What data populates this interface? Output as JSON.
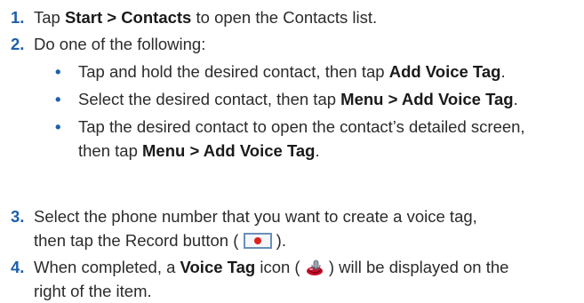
{
  "steps": [
    {
      "num": "1.",
      "t1": "Tap ",
      "b1": "Start > Contacts",
      "t2": " to open the Contacts list."
    },
    {
      "num": "2.",
      "t1": "Do one of the following:"
    },
    {
      "num": "3.",
      "t1": "Select the phone number that you want to create a voice tag,",
      "t2": "then tap the Record button (",
      "t3": ")."
    },
    {
      "num": "4.",
      "t1": "When completed, a ",
      "b1": "Voice Tag",
      "t2": " icon (",
      "t3": ") will be displayed on the",
      "t4": "right of the item."
    }
  ],
  "bullets": [
    {
      "dot": "•",
      "t1": "Tap and hold the desired contact, then tap ",
      "b1": "Add Voice Tag",
      "t2": "."
    },
    {
      "dot": "•",
      "t1": "Select the desired contact, then tap ",
      "b1": "Menu > Add Voice Tag",
      "t2": "."
    },
    {
      "dot": "•",
      "t1": "Tap the desired contact to open the contact’s detailed screen,",
      "t2": "then tap ",
      "b1": "Menu > Add Voice Tag",
      "t3": "."
    }
  ],
  "icons": {
    "record": "record-button-icon",
    "voice_tag": "voice-tag-icon"
  },
  "colors": {
    "number": "#1e5fa8",
    "text": "#2b2b2b",
    "record_dot": "#e0201c",
    "record_border": "#6a8fb8"
  }
}
